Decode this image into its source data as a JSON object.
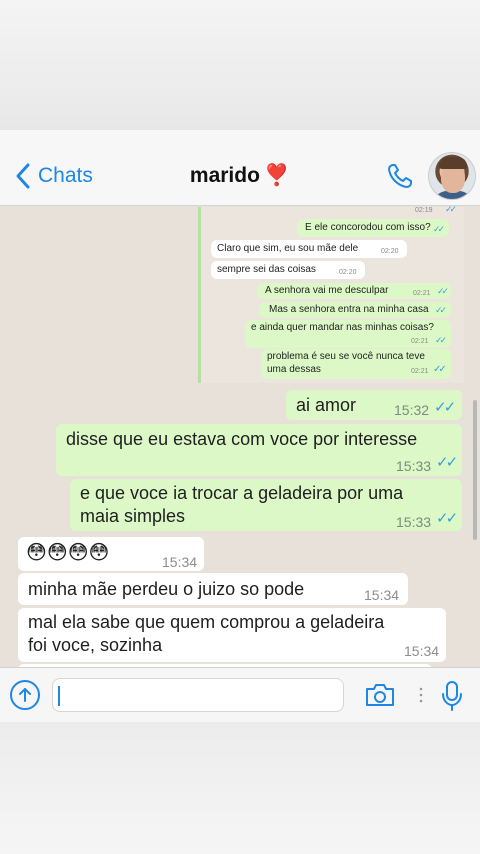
{
  "header": {
    "back_label": "Chats",
    "contact_name": "marido",
    "contact_emoji": "❣️"
  },
  "embedded_chat": {
    "messages": [
      {
        "type": "time_only",
        "time": "02:19"
      },
      {
        "type": "out",
        "text": "E ele concorodou com isso?"
      },
      {
        "type": "in",
        "text": "Claro que sim, eu sou mãe dele",
        "time": "02:20"
      },
      {
        "type": "in",
        "text": "sempre sei das coisas",
        "time": "02:20"
      },
      {
        "type": "out",
        "text": "A senhora vai me desculpar",
        "time": "02:21"
      },
      {
        "type": "out",
        "text": "Mas a senhora entra na minha casa"
      },
      {
        "type": "out",
        "text": "e ainda quer mandar nas minhas coisas?",
        "time": "02:21"
      },
      {
        "type": "out",
        "text_line1": "problema é seu se você nunca teve",
        "text_line2": "uma dessas",
        "time": "02:21"
      }
    ]
  },
  "messages": [
    {
      "direction": "out",
      "text": "ai amor",
      "time": "15:32"
    },
    {
      "direction": "out",
      "text": "disse que eu estava com voce por interesse",
      "time": "15:33"
    },
    {
      "direction": "out",
      "text_line1": "e que voce ia trocar a geladeira por uma",
      "text_line2": "maia simples",
      "time": "15:33"
    },
    {
      "direction": "in",
      "text": "😳😳😳😳",
      "time": "15:34"
    },
    {
      "direction": "in",
      "text": "minha mãe perdeu o juizo so pode",
      "time": "15:34"
    },
    {
      "direction": "in",
      "text_line1": "mal ela sabe que quem comprou a geladeira",
      "text_line2": "foi voce, sozinha",
      "time": "15:34"
    }
  ],
  "input": {
    "value": "",
    "placeholder": ""
  },
  "colors": {
    "accent": "#1d87e5",
    "outgoing_bubble": "#dcf8c6",
    "incoming_bubble": "#ffffff",
    "chat_background": "#e8e1d9",
    "read_ticks": "#39a0d8",
    "heart": "#e0262b"
  },
  "icons": [
    "chevron-left-icon",
    "phone-icon",
    "avatar",
    "share-arrow-icon",
    "camera-icon",
    "more-dots-icon",
    "microphone-icon",
    "double-check-icon"
  ]
}
